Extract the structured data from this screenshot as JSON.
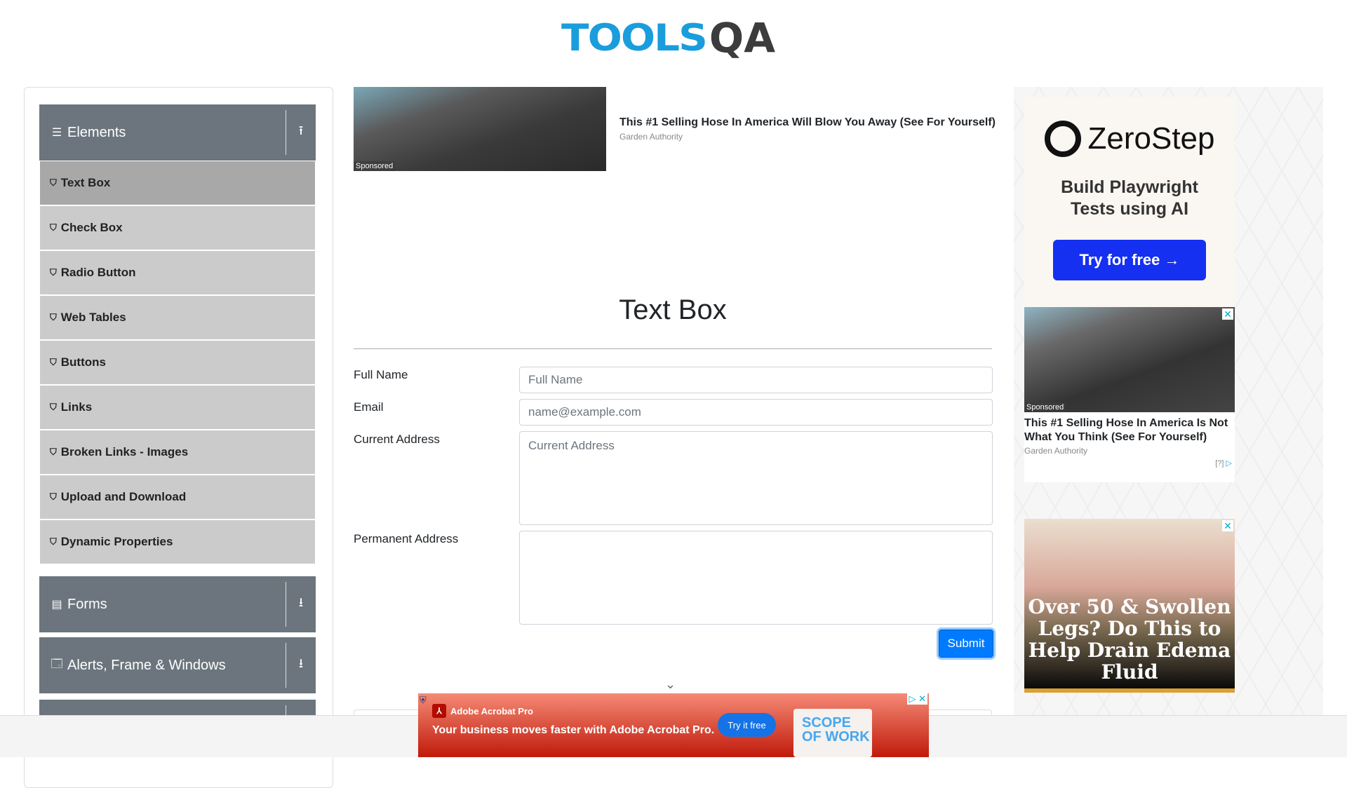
{
  "logo": {
    "tools": "TOOLS",
    "qa": "QA"
  },
  "sidebar": {
    "groups": [
      {
        "label": "Elements",
        "icon": "hamburger-icon",
        "toggle": "collapse-icon"
      },
      {
        "label": "Forms",
        "icon": "form-icon",
        "toggle": "expand-icon"
      },
      {
        "label": "Alerts, Frame & Windows",
        "icon": "window-icon",
        "toggle": "expand-icon"
      }
    ],
    "items": [
      "Text Box",
      "Check Box",
      "Radio Button",
      "Web Tables",
      "Buttons",
      "Links",
      "Broken Links - Images",
      "Upload and Download",
      "Dynamic Properties"
    ]
  },
  "top_ad": {
    "sponsored": "Sponsored",
    "title": "This #1 Selling Hose In America Will Blow You Away (See For Yourself)",
    "source": "Garden Authority"
  },
  "main": {
    "title": "Text Box",
    "form": {
      "full_name": {
        "label": "Full Name",
        "placeholder": "Full Name"
      },
      "email": {
        "label": "Email",
        "placeholder": "name@example.com"
      },
      "current_address": {
        "label": "Current Address",
        "placeholder": "Current Address"
      },
      "permanent_address": {
        "label": "Permanent Address",
        "placeholder": ""
      },
      "submit": "Submit"
    }
  },
  "right_ads": {
    "zerostep": {
      "brand": "ZeroStep",
      "tagline1": "Build Playwright",
      "tagline2": "Tests using AI",
      "cta": "Try for free →"
    },
    "hose": {
      "sponsored": "Sponsored",
      "title": "This #1 Selling Hose In America Is Not What You Think (See For Yourself)",
      "source": "Garden Authority",
      "info": "[?]"
    },
    "edema": {
      "text": "Over 50 & Swollen Legs? Do This to Help Drain Edema Fluid"
    }
  },
  "bottom_ad": {
    "brand": "Adobe Acrobat Pro",
    "message": "Your business moves faster with Adobe Acrobat Pro.",
    "cta": "Try it free",
    "doc": "SCOPE OF WORK"
  },
  "colors": {
    "brand_blue": "#1a9ddc",
    "sidebar_header": "#6c757d",
    "submit": "#007bff"
  }
}
